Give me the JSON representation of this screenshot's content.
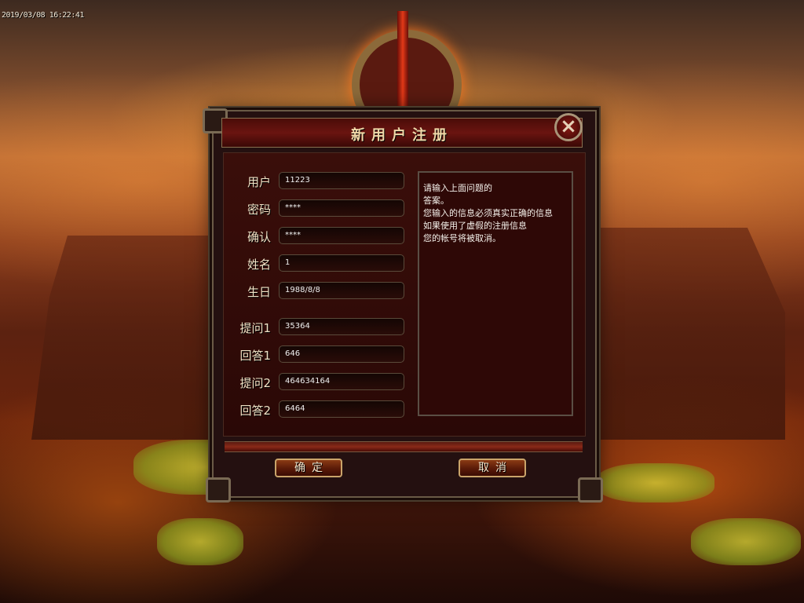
{
  "timestamp": "2019/03/08 16:22:41",
  "dialog": {
    "title": "新用户注册",
    "close_icon": "×"
  },
  "form": {
    "fields": [
      {
        "label": "用户",
        "value": "11223"
      },
      {
        "label": "密码",
        "value": "****"
      },
      {
        "label": "确认",
        "value": "****"
      },
      {
        "label": "姓名",
        "value": "1"
      },
      {
        "label": "生日",
        "value": "1988/8/8"
      },
      {
        "label": "提问1",
        "value": "35364"
      },
      {
        "label": "回答1",
        "value": "646"
      },
      {
        "label": "提问2",
        "value": "464634164"
      },
      {
        "label": "回答2",
        "value": "6464"
      }
    ]
  },
  "help": {
    "lines": [
      "请输入上面问题的",
      "答案。",
      "您输入的信息必须真实正确的信息",
      "如果使用了虚假的注册信息",
      "您的帐号将被取消。"
    ]
  },
  "buttons": {
    "ok_label": "确定",
    "cancel_label": "取消"
  },
  "colors": {
    "label_text": "#f2e2c6",
    "button_border": "#caa46a",
    "dialog_bg": "#241010"
  },
  "icons": {
    "close": "close-icon"
  }
}
